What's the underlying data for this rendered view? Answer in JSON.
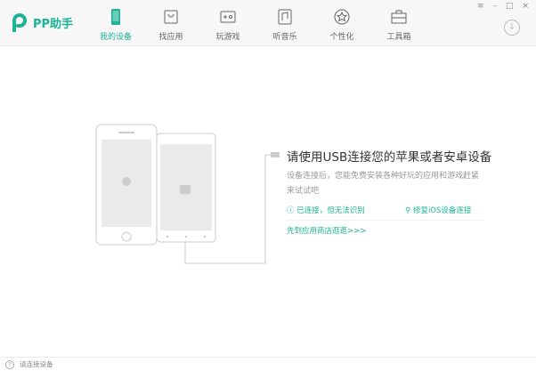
{
  "app": {
    "name": "PP助手"
  },
  "tabs": [
    {
      "label": "我的设备",
      "icon": "phone-icon",
      "active": true
    },
    {
      "label": "找应用",
      "icon": "bag-icon"
    },
    {
      "label": "玩游戏",
      "icon": "gamepad-icon"
    },
    {
      "label": "听音乐",
      "icon": "music-icon"
    },
    {
      "label": "个性化",
      "icon": "star-icon"
    },
    {
      "label": "工具箱",
      "icon": "toolbox-icon"
    }
  ],
  "window": {
    "menu": "≡",
    "min": "–",
    "max": "□",
    "close": "×",
    "download": "↓"
  },
  "main": {
    "title": "请使用USB连接您的苹果或者安卓设备",
    "desc": "设备连接后，您能免费安装各种好玩的应用和游戏赶紧来试试吧",
    "link_unrecognized": "已连接，但无法识别",
    "link_repair": "修复iOS设备连接",
    "link_store": "先到应用商店逛逛>>>"
  },
  "status": {
    "text": "请连接设备"
  },
  "colors": {
    "accent": "#1ab394"
  }
}
